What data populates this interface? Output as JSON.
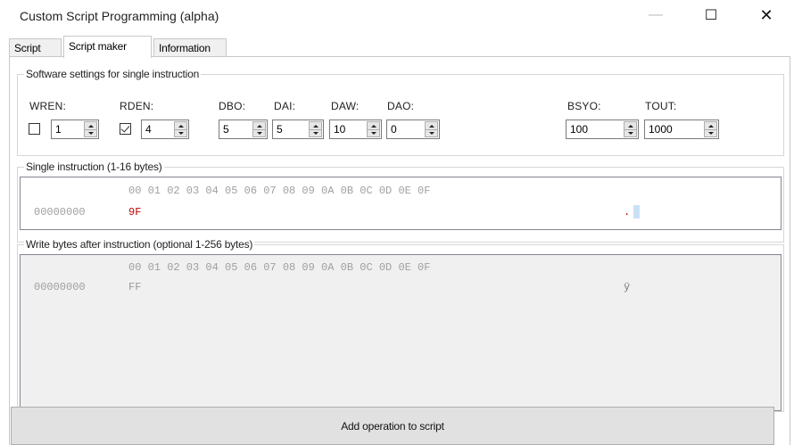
{
  "window": {
    "title": "Custom Script Programming (alpha)",
    "minimize_glyph": "—",
    "maximize_glyph": "☐",
    "close_glyph": "✕"
  },
  "tabs": [
    {
      "label": "Script"
    },
    {
      "label": "Script maker"
    },
    {
      "label": "Information"
    }
  ],
  "software_settings": {
    "title": "Software settings for single instruction",
    "wren": {
      "label": "WREN:",
      "checked": false,
      "value": "1"
    },
    "rden": {
      "label": "RDEN:",
      "checked": true,
      "value": "4"
    },
    "dbo": {
      "label": "DBO:",
      "value": "5"
    },
    "dai": {
      "label": "DAI:",
      "value": "5"
    },
    "daw": {
      "label": "DAW:",
      "value": "10"
    },
    "dao": {
      "label": "DAO:",
      "value": "0"
    },
    "bsyo": {
      "label": "BSYO:",
      "value": "100"
    },
    "tout": {
      "label": "TOUT:",
      "value": "1000"
    }
  },
  "single_instruction": {
    "title": "Single instruction (1-16 bytes)",
    "header": "00 01 02 03 04 05 06 07 08 09 0A 0B 0C 0D 0E 0F",
    "offset": "00000000",
    "bytes": "9F",
    "ascii": "."
  },
  "write_bytes": {
    "title": "Write bytes after instruction (optional 1-256 bytes)",
    "header": "00 01 02 03 04 05 06 07 08 09 0A 0B 0C 0D 0E 0F",
    "offset": "00000000",
    "bytes": "FF",
    "ascii": "ÿ"
  },
  "add_button": {
    "label": "Add operation to script"
  },
  "colors": {
    "hex_value": "#c00000",
    "hex_header": "#a0a0a0",
    "button_bg": "#e1e1e1"
  }
}
